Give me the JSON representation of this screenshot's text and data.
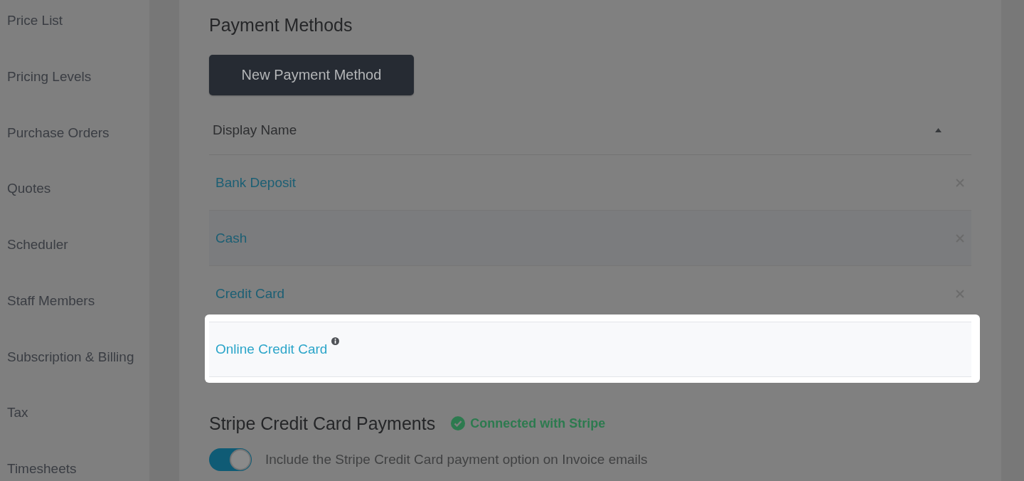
{
  "sidebar": {
    "items": [
      "Price List",
      "Pricing Levels",
      "Purchase Orders",
      "Quotes",
      "Scheduler",
      "Staff Members",
      "Subscription & Billing",
      "Tax",
      "Timesheets"
    ]
  },
  "payment_methods": {
    "title": "Payment Methods",
    "new_button": "New Payment Method",
    "table": {
      "columns": [
        {
          "label": "Display Name",
          "sorted": true,
          "ascending": true
        }
      ],
      "rows": [
        {
          "name": "Bank Deposit",
          "removable": true,
          "hovered": false,
          "highlighted": false,
          "info": false
        },
        {
          "name": "Cash",
          "removable": true,
          "hovered": true,
          "highlighted": false,
          "info": false
        },
        {
          "name": "Credit Card",
          "removable": true,
          "hovered": false,
          "highlighted": false,
          "info": false
        },
        {
          "name": "Online Credit Card",
          "removable": false,
          "hovered": false,
          "highlighted": true,
          "info": true
        }
      ]
    }
  },
  "stripe": {
    "title": "Stripe Credit Card Payments",
    "status": {
      "text": "Connected with Stripe",
      "connected": true
    },
    "toggle": {
      "label": "Include the Stripe Credit Card payment option on Invoice emails",
      "on": true
    }
  }
}
